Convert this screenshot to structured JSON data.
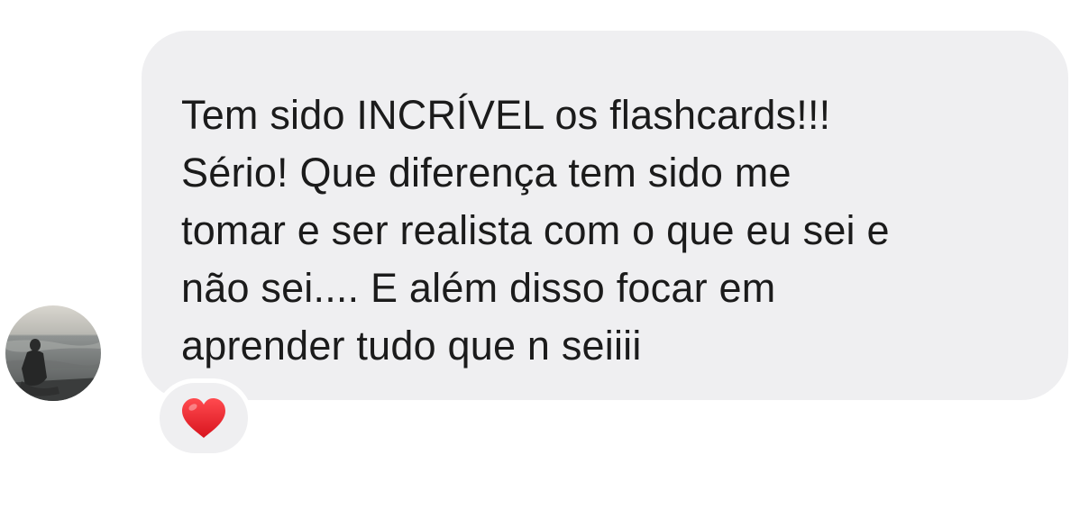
{
  "message": {
    "lines": [
      "Tem sido INCRÍVEL os flashcards!!!",
      "Sério! Que diferença tem sido me",
      "tomar e ser realista com o que eu sei e",
      "não sei.... E além disso focar em",
      "aprender tudo que n seiiii"
    ]
  },
  "avatar": {
    "icon": "avatar-photo-person-by-sea"
  },
  "reaction": {
    "icon": "red-heart-icon",
    "color": "#e8232e"
  },
  "colors": {
    "bubble": "#efeff1",
    "text": "#1b1b1b",
    "background": "#ffffff"
  }
}
